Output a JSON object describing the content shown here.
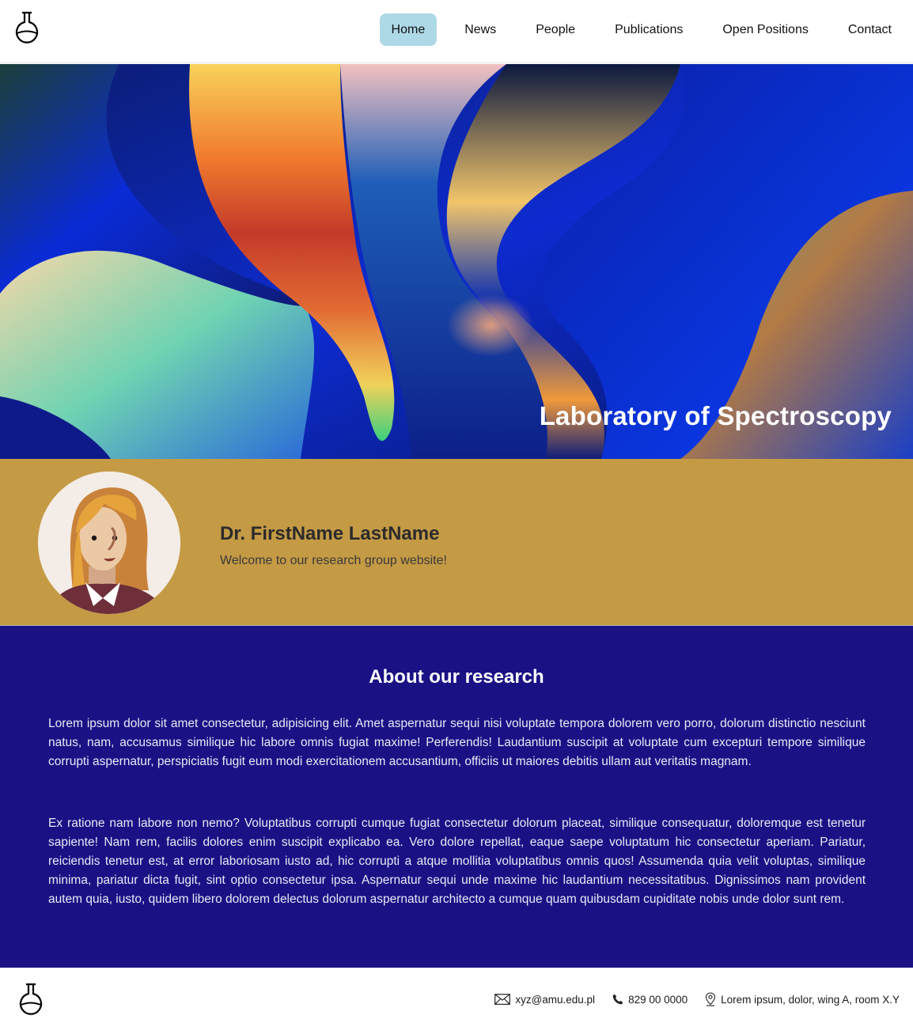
{
  "nav": {
    "items": [
      {
        "label": "Home",
        "active": true
      },
      {
        "label": "News",
        "active": false
      },
      {
        "label": "People",
        "active": false
      },
      {
        "label": "Publications",
        "active": false
      },
      {
        "label": "Open Positions",
        "active": false
      },
      {
        "label": "Contact",
        "active": false
      }
    ]
  },
  "hero": {
    "title": "Laboratory of Spectroscopy"
  },
  "welcome": {
    "name": "Dr. FirstName LastName",
    "greeting": "Welcome to our research group website!"
  },
  "about": {
    "title": "About our research",
    "paragraphs": [
      "Lorem ipsum dolor sit amet consectetur, adipisicing elit. Amet aspernatur sequi nisi voluptate tempora dolorem vero porro, dolorum distinctio nesciunt natus, nam, accusamus similique hic labore omnis fugiat maxime! Perferendis! Laudantium suscipit at voluptate cum excepturi tempore similique corrupti aspernatur, perspiciatis fugit eum modi exercitationem accusantium, officiis ut maiores debitis ullam aut veritatis magnam.",
      "Ex ratione nam labore non nemo? Voluptatibus corrupti cumque fugiat consectetur dolorum placeat, similique consequatur, doloremque est tenetur sapiente! Nam rem, facilis dolores enim suscipit explicabo ea. Vero dolore repellat, eaque saepe voluptatum hic consectetur aperiam. Pariatur, reiciendis tenetur est, at error laboriosam iusto ad, hic corrupti a atque mollitia voluptatibus omnis quos! Assumenda quia velit voluptas, similique minima, pariatur dicta fugit, sint optio consectetur ipsa. Aspernatur sequi unde maxime hic laudantium necessitatibus. Dignissimos nam provident autem quia, iusto, quidem libero dolorem delectus dolorum aspernatur architecto a cumque quam quibusdam cupiditate nobis unde dolor sunt rem."
    ]
  },
  "footer": {
    "email": "xyz@amu.edu.pl",
    "phone": "829 00 0000",
    "address": "Lorem ipsum, dolor, wing A, room X.Y",
    "icons": [
      "envelope-icon",
      "phone-icon",
      "location-pin-icon"
    ]
  },
  "colors": {
    "nav_active": "#add8e6",
    "welcome_band": "#c49a45",
    "about_band": "#1a1185",
    "hero_title": "#ffffff"
  }
}
